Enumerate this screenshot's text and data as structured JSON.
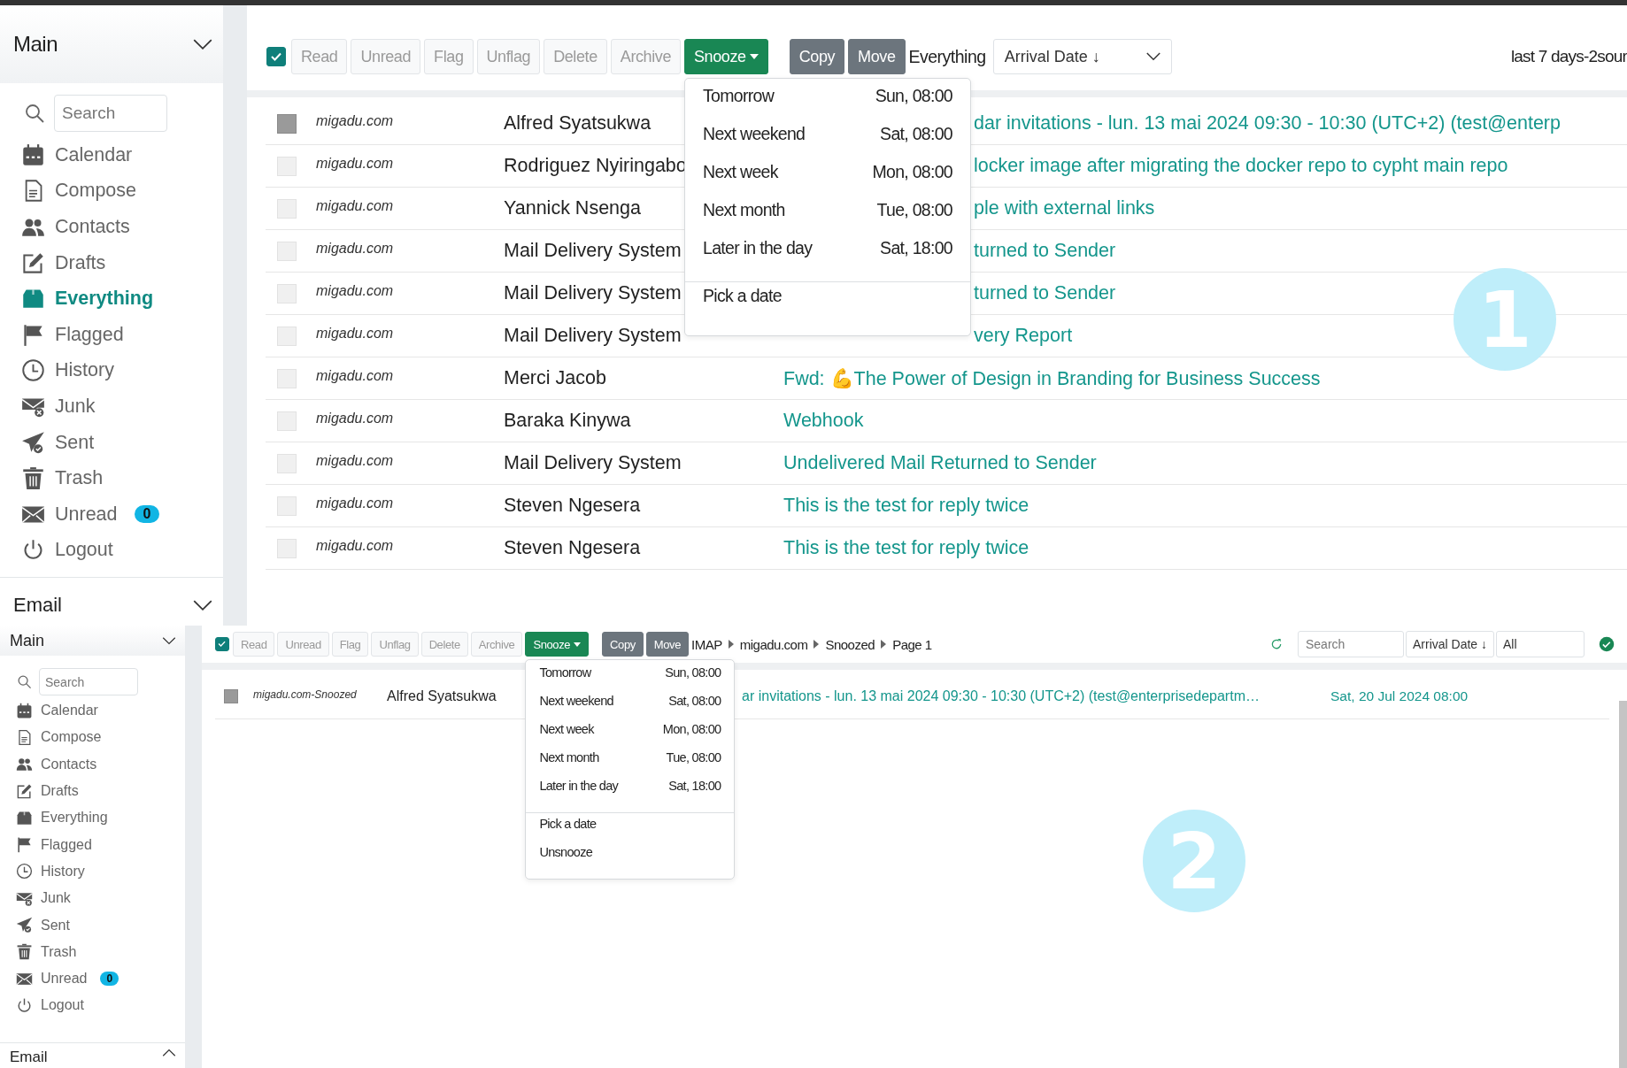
{
  "panels": [
    {
      "sidebar": {
        "title": "Main",
        "title_expanded": true,
        "search": {
          "placeholder": "Search"
        },
        "items": [
          {
            "label": "Calendar",
            "selected": false
          },
          {
            "label": "Compose",
            "selected": false
          },
          {
            "label": "Contacts",
            "selected": false
          },
          {
            "label": "Drafts",
            "selected": false
          },
          {
            "label": "Everything",
            "selected": true
          },
          {
            "label": "Flagged",
            "selected": false
          },
          {
            "label": "History",
            "selected": false
          },
          {
            "label": "Junk",
            "selected": false
          },
          {
            "label": "Sent",
            "selected": false
          },
          {
            "label": "Trash",
            "selected": false
          },
          {
            "label": "Unread",
            "selected": false,
            "badge": "0"
          },
          {
            "label": "Logout",
            "selected": false
          }
        ],
        "section": {
          "title": "Email",
          "expanded": true
        }
      },
      "toolbar": {
        "select_all": {
          "checked": true
        },
        "buttons": [
          {
            "label": "Read",
            "kind": "action"
          },
          {
            "label": "Unread",
            "kind": "action"
          },
          {
            "label": "Flag",
            "kind": "action"
          },
          {
            "label": "Unflag",
            "kind": "action"
          },
          {
            "label": "Delete",
            "kind": "action"
          },
          {
            "label": "Archive",
            "kind": "action"
          },
          {
            "label": "Snooze",
            "kind": "dropdown"
          },
          {
            "label": "Copy",
            "kind": "dark"
          },
          {
            "label": "Move",
            "kind": "dark"
          }
        ],
        "folder": "Everything",
        "sort": "Arrival Date ↓",
        "range": "last 7 days-2sour"
      },
      "snooze_menu": {
        "options": [
          {
            "label": "Tomorrow",
            "time": "Sun, 08:00"
          },
          {
            "label": "Next weekend",
            "time": "Sat, 08:00"
          },
          {
            "label": "Next week",
            "time": "Mon, 08:00"
          },
          {
            "label": "Next month",
            "time": "Tue, 08:00"
          },
          {
            "label": "Later in the day",
            "time": "Sat, 18:00"
          }
        ],
        "actions": [
          "Pick a date"
        ]
      },
      "rows": [
        {
          "checked": true,
          "source": "migadu.com",
          "sender": "Alfred Syatsukwa",
          "subject": "dar invitations - lun. 13 mai 2024 09:30 - 10:30 (UTC+2) (test@enterp",
          "covered": true
        },
        {
          "checked": false,
          "source": "migadu.com",
          "sender": "Rodriguez Nyiringabo",
          "subject": "locker image after migrating the docker repo to cypht main repo",
          "covered": true
        },
        {
          "checked": false,
          "source": "migadu.com",
          "sender": "Yannick Nsenga",
          "subject": "ple with external links",
          "covered": true
        },
        {
          "checked": false,
          "source": "migadu.com",
          "sender": "Mail Delivery System",
          "subject": "turned to Sender",
          "covered": true
        },
        {
          "checked": false,
          "source": "migadu.com",
          "sender": "Mail Delivery System",
          "subject": "turned to Sender",
          "covered": true
        },
        {
          "checked": false,
          "source": "migadu.com",
          "sender": "Mail Delivery System",
          "subject": "very Report",
          "covered": true
        },
        {
          "checked": false,
          "source": "migadu.com",
          "sender": "Merci Jacob",
          "subject": "Fwd: 💪The Power of Design in Branding for Business Success",
          "covered": false
        },
        {
          "checked": false,
          "source": "migadu.com",
          "sender": "Baraka Kinywa",
          "subject": "Webhook"
        },
        {
          "checked": false,
          "source": "migadu.com",
          "sender": "Mail Delivery System",
          "subject": "Undelivered Mail Returned to Sender"
        },
        {
          "checked": false,
          "source": "migadu.com",
          "sender": "Steven Ngesera",
          "subject": "This is the test for reply twice"
        },
        {
          "checked": false,
          "source": "migadu.com",
          "sender": "Steven Ngesera",
          "subject": "This is the test for reply twice"
        }
      ],
      "marker": "1"
    },
    {
      "sidebar": {
        "title": "Main",
        "title_expanded": true,
        "search": {
          "placeholder": "Search"
        },
        "items": [
          {
            "label": "Calendar",
            "selected": false
          },
          {
            "label": "Compose",
            "selected": false
          },
          {
            "label": "Contacts",
            "selected": false
          },
          {
            "label": "Drafts",
            "selected": false
          },
          {
            "label": "Everything",
            "selected": false
          },
          {
            "label": "Flagged",
            "selected": false
          },
          {
            "label": "History",
            "selected": false
          },
          {
            "label": "Junk",
            "selected": false
          },
          {
            "label": "Sent",
            "selected": false
          },
          {
            "label": "Trash",
            "selected": false
          },
          {
            "label": "Unread",
            "selected": false,
            "badge": "0"
          },
          {
            "label": "Logout",
            "selected": false
          }
        ],
        "section": {
          "title": "Email",
          "expanded": false
        }
      },
      "toolbar": {
        "select_all": {
          "checked": true
        },
        "buttons": [
          {
            "label": "Read",
            "kind": "action"
          },
          {
            "label": "Unread",
            "kind": "action"
          },
          {
            "label": "Flag",
            "kind": "action"
          },
          {
            "label": "Unflag",
            "kind": "action"
          },
          {
            "label": "Delete",
            "kind": "action"
          },
          {
            "label": "Archive",
            "kind": "action"
          },
          {
            "label": "Snooze",
            "kind": "dropdown"
          },
          {
            "label": "Copy",
            "kind": "dark"
          },
          {
            "label": "Move",
            "kind": "dark"
          }
        ],
        "breadcrumb": [
          "IMAP",
          "migadu.com",
          "Snoozed",
          "Page 1"
        ],
        "search": {
          "placeholder": "Search"
        },
        "sort": "Arrival Date ↓",
        "filter": "All"
      },
      "snooze_menu": {
        "options": [
          {
            "label": "Tomorrow",
            "time": "Sun, 08:00"
          },
          {
            "label": "Next weekend",
            "time": "Sat, 08:00"
          },
          {
            "label": "Next week",
            "time": "Mon, 08:00"
          },
          {
            "label": "Next month",
            "time": "Tue, 08:00"
          },
          {
            "label": "Later in the day",
            "time": "Sat, 18:00"
          }
        ],
        "actions": [
          "Pick a date",
          "Unsnooze"
        ]
      },
      "rows": [
        {
          "checked": true,
          "source": "migadu.com-Snoozed",
          "sender": "Alfred Syatsukwa",
          "subject": "ar invitations - lun. 13 mai 2024 09:30 - 10:30 (UTC+2) (test@enterprisedepartm…",
          "covered": true,
          "date": "Sat, 20 Jul 2024 08:00"
        }
      ],
      "marker": "2"
    }
  ]
}
